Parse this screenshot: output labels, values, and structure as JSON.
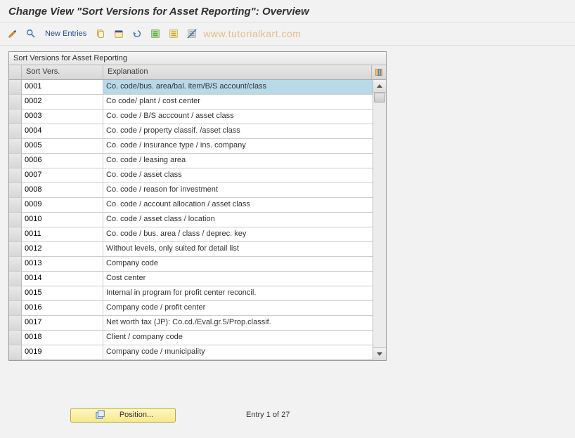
{
  "title": "Change View \"Sort Versions for Asset Reporting\": Overview",
  "toolbar": {
    "new_entries": "New Entries"
  },
  "watermark": "www.tutorialkart.com",
  "table": {
    "caption": "Sort Versions for Asset Reporting",
    "col_sort": "Sort Vers.",
    "col_exp": "Explanation",
    "rows": [
      {
        "sv": "0001",
        "exp": "Co. code/bus. area/bal. item/B/S account/class",
        "selected": true
      },
      {
        "sv": "0002",
        "exp": "Co code/ plant / cost center"
      },
      {
        "sv": "0003",
        "exp": "Co. code / B/S acccount / asset class"
      },
      {
        "sv": "0004",
        "exp": "Co. code / property classif. /asset class"
      },
      {
        "sv": "0005",
        "exp": "Co. code / insurance type / ins. company"
      },
      {
        "sv": "0006",
        "exp": "Co. code / leasing area"
      },
      {
        "sv": "0007",
        "exp": "Co. code / asset class"
      },
      {
        "sv": "0008",
        "exp": "Co. code / reason for investment"
      },
      {
        "sv": "0009",
        "exp": "Co. code / account allocation / asset class"
      },
      {
        "sv": "0010",
        "exp": "Co. code / asset class / location"
      },
      {
        "sv": "0011",
        "exp": "Co. code / bus. area / class / deprec. key"
      },
      {
        "sv": "0012",
        "exp": "Without levels, only suited for detail list"
      },
      {
        "sv": "0013",
        "exp": "Company code"
      },
      {
        "sv": "0014",
        "exp": "Cost center"
      },
      {
        "sv": "0015",
        "exp": "Internal in program for profit center reconcil."
      },
      {
        "sv": "0016",
        "exp": "Company code / profit center"
      },
      {
        "sv": "0017",
        "exp": "Net worth tax (JP): Co.cd./Eval.gr.5/Prop.classif."
      },
      {
        "sv": "0018",
        "exp": "Client / company code"
      },
      {
        "sv": "0019",
        "exp": "Company code / municipality"
      }
    ]
  },
  "position_button": "Position...",
  "entry_status": "Entry 1 of 27"
}
